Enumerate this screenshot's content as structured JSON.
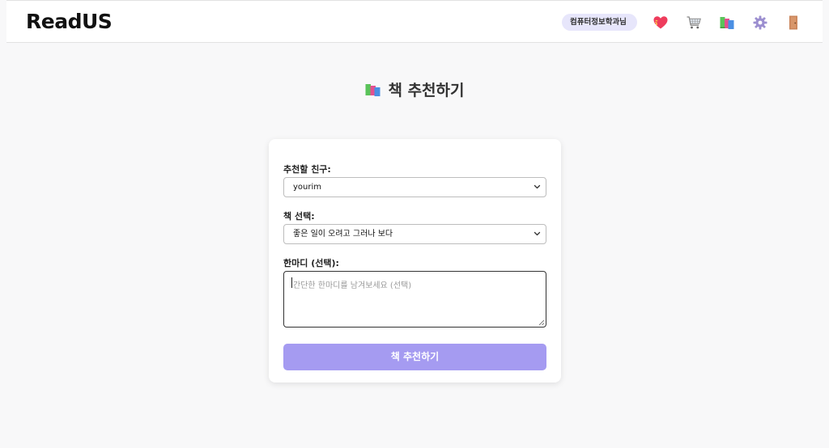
{
  "header": {
    "logo": "ReadUS",
    "user_badge": "컴퓨터정보학과님",
    "icons": [
      "heart-icon",
      "cart-icon",
      "books-icon",
      "gear-icon",
      "door-icon"
    ]
  },
  "page": {
    "title": "책 추천하기"
  },
  "form": {
    "friend_label": "추천할 친구:",
    "friend_value": "yourim",
    "book_label": "책 선택:",
    "book_value": "좋은 일이 오려고 그러나 보다",
    "message_label": "한마디 (선택):",
    "message_placeholder": "간단한 한마디를 남겨보세요 (선택)",
    "submit_label": "책 추천하기"
  },
  "colors": {
    "accent": "#a59bf1",
    "badge_bg": "#e7e6fb"
  }
}
